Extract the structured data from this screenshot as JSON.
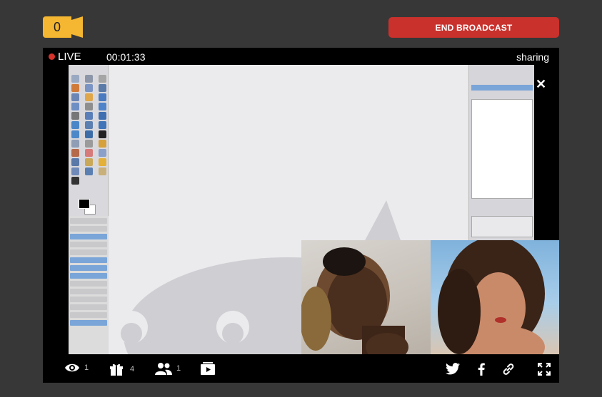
{
  "header": {
    "viewer_badge_count": "0",
    "end_broadcast_label": "END BROADCAST"
  },
  "stage": {
    "live_label": "LIVE",
    "timer": "00:01:33",
    "sharing_label": "sharing",
    "close_glyph": "✕"
  },
  "toolbar": {
    "views_count": "1",
    "gifts_count": "4",
    "users_count": "1"
  },
  "colors": {
    "background": "#373737",
    "badge": "#f5b731",
    "end_button": "#c8312c",
    "live_dot": "#d4322a",
    "stage": "#000000"
  },
  "icons": {
    "badge": "video-camera-icon",
    "views": "eye-icon",
    "gifts": "gift-icon",
    "users": "users-icon",
    "media": "media-playlist-icon",
    "twitter": "twitter-icon",
    "facebook": "facebook-icon",
    "link": "link-icon",
    "fullscreen": "fullscreen-icon",
    "close": "close-icon"
  }
}
